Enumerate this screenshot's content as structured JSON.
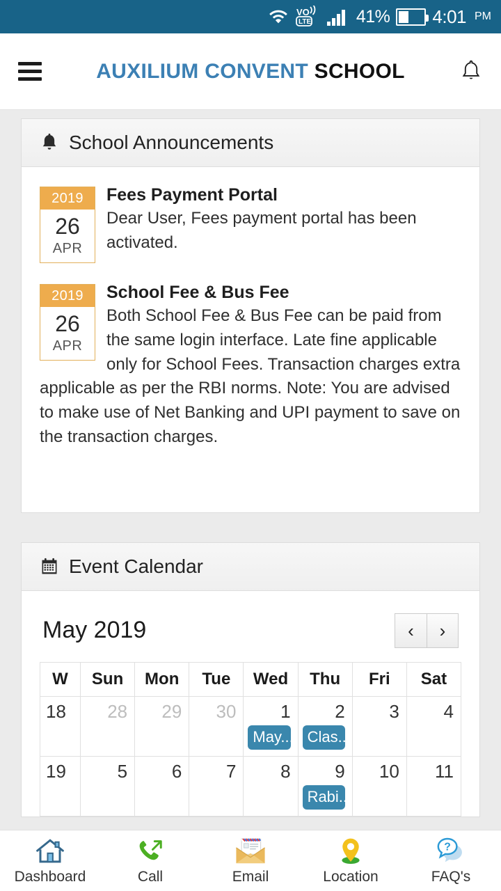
{
  "status_bar": {
    "wifi_icon": "wifi-icon",
    "volte_icon": "volte-icon",
    "volte_top_label": "VO",
    "volte_bottom_label": "LTE",
    "signal_icon": "signal-bars-icon",
    "battery_percent": "41%",
    "battery_icon": "battery-icon",
    "time": "4:01",
    "am_pm": "PM",
    "background_color": "#186388"
  },
  "header": {
    "menu_icon": "hamburger-menu-icon",
    "title_primary": "AUXILIUM CONVENT",
    "title_secondary": "SCHOOL",
    "title_primary_color": "#3c80b4",
    "title_secondary_color": "#111111",
    "notification_icon": "bell-icon"
  },
  "announcements_card": {
    "icon": "bell-icon",
    "title": "School Announcements",
    "items": [
      {
        "year": "2019",
        "day": "26",
        "month": "APR",
        "title": "Fees Payment Portal",
        "text": "Dear User, Fees payment portal has been activated."
      },
      {
        "year": "2019",
        "day": "26",
        "month": "APR",
        "title": "School Fee & Bus Fee",
        "text": "Both School Fee & Bus Fee can be paid from the same login interface. Late fine applicable only for School Fees. Transaction charges extra applicable as per the RBI norms. Note: You are advised to make use of Net Banking and UPI payment to save on the transaction charges."
      }
    ]
  },
  "calendar_card": {
    "icon": "calendar-icon",
    "title": "Event Calendar",
    "month_label": "May 2019",
    "prev_label": "‹",
    "next_label": "›",
    "columns": [
      "W",
      "Sun",
      "Mon",
      "Tue",
      "Wed",
      "Thu",
      "Fri",
      "Sat"
    ],
    "weeks": [
      {
        "week_number": "18",
        "days": [
          {
            "number": "28",
            "other_month": true,
            "today": false,
            "events": []
          },
          {
            "number": "29",
            "other_month": true,
            "today": false,
            "events": []
          },
          {
            "number": "30",
            "other_month": true,
            "today": false,
            "events": []
          },
          {
            "number": "1",
            "other_month": false,
            "today": false,
            "events": [
              "May..."
            ]
          },
          {
            "number": "2",
            "other_month": false,
            "today": false,
            "events": [
              "Clas..."
            ]
          },
          {
            "number": "3",
            "other_month": false,
            "today": false,
            "events": []
          },
          {
            "number": "4",
            "other_month": false,
            "today": false,
            "events": []
          }
        ]
      },
      {
        "week_number": "19",
        "days": [
          {
            "number": "5",
            "other_month": false,
            "today": false,
            "events": []
          },
          {
            "number": "6",
            "other_month": false,
            "today": false,
            "events": []
          },
          {
            "number": "7",
            "other_month": false,
            "today": false,
            "events": []
          },
          {
            "number": "8",
            "other_month": false,
            "today": true,
            "events": []
          },
          {
            "number": "9",
            "other_month": false,
            "today": false,
            "events": [
              "Rabi..."
            ]
          },
          {
            "number": "10",
            "other_month": false,
            "today": false,
            "events": []
          },
          {
            "number": "11",
            "other_month": false,
            "today": false,
            "events": []
          }
        ]
      }
    ],
    "event_chip_color": "#3a87ad",
    "today_highlight_color": "#dbeefa"
  },
  "bottom_nav": {
    "items": [
      {
        "label": "Dashboard",
        "icon": "home-icon"
      },
      {
        "label": "Call",
        "icon": "phone-icon"
      },
      {
        "label": "Email",
        "icon": "envelope-icon"
      },
      {
        "label": "Location",
        "icon": "map-pin-icon"
      },
      {
        "label": "FAQ's",
        "icon": "question-speech-bubble-icon"
      }
    ]
  }
}
